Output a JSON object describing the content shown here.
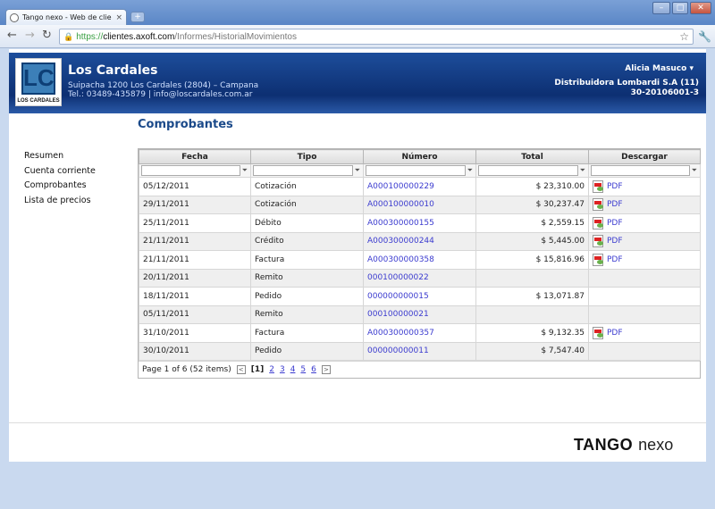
{
  "browser": {
    "tab_title": "Tango nexo - Web de clientes",
    "tab_close": "×",
    "new_tab": "+",
    "url_scheme": "https://",
    "url_host": "clientes.axoft.com",
    "url_path": "/Informes/HistorialMovimientos",
    "back_icon": "back-arrow-icon",
    "forward_icon": "forward-arrow-icon",
    "reload_icon": "reload-icon"
  },
  "header": {
    "company_name": "Los Cardales",
    "address": "Suipacha 1200 Los Cardales (2804) – Campana",
    "contact": "Tel.: 03489-435879 | info@loscardales.com.ar",
    "logo_initials": "LC",
    "logo_text": "LOS CARDALES",
    "user_name": "Alicia Masuco",
    "distributor": "Distribuidora Lombardi S.A (11)",
    "distributor_id": "30-20106001-3"
  },
  "sidebar": {
    "items": [
      {
        "label": "Resumen"
      },
      {
        "label": "Cuenta corriente"
      },
      {
        "label": "Comprobantes"
      },
      {
        "label": "Lista de precios"
      }
    ]
  },
  "main": {
    "title": "Comprobantes",
    "columns": [
      "Fecha",
      "Tipo",
      "Número",
      "Total",
      "Descargar"
    ],
    "rows": [
      {
        "fecha": "05/12/2011",
        "tipo": "Cotización",
        "numero": "A000100000229",
        "total": "$ 23,310.00",
        "pdf": "PDF"
      },
      {
        "fecha": "29/11/2011",
        "tipo": "Cotización",
        "numero": "A000100000010",
        "total": "$ 30,237.47",
        "pdf": "PDF"
      },
      {
        "fecha": "25/11/2011",
        "tipo": "Débito",
        "numero": "A000300000155",
        "total": "$ 2,559.15",
        "pdf": "PDF"
      },
      {
        "fecha": "21/11/2011",
        "tipo": "Crédito",
        "numero": "A000300000244",
        "total": "$ 5,445.00",
        "pdf": "PDF"
      },
      {
        "fecha": "21/11/2011",
        "tipo": "Factura",
        "numero": "A000300000358",
        "total": "$ 15,816.96",
        "pdf": "PDF"
      },
      {
        "fecha": "20/11/2011",
        "tipo": "Remito",
        "numero": "000100000022",
        "total": "",
        "pdf": ""
      },
      {
        "fecha": "18/11/2011",
        "tipo": "Pedido",
        "numero": "000000000015",
        "total": "$ 13,071.87",
        "pdf": ""
      },
      {
        "fecha": "05/11/2011",
        "tipo": "Remito",
        "numero": "000100000021",
        "total": "",
        "pdf": ""
      },
      {
        "fecha": "31/10/2011",
        "tipo": "Factura",
        "numero": "A000300000357",
        "total": "$ 9,132.35",
        "pdf": "PDF"
      },
      {
        "fecha": "30/10/2011",
        "tipo": "Pedido",
        "numero": "000000000011",
        "total": "$ 7,547.40",
        "pdf": ""
      }
    ],
    "pager": {
      "summary": "Page 1 of 6 (52 items)",
      "current": "[1]",
      "pages": [
        "2",
        "3",
        "4",
        "5",
        "6"
      ],
      "prev": "<",
      "next": ">"
    }
  },
  "footer": {
    "brand_bold": "TANGO",
    "brand_light": "nexo"
  }
}
